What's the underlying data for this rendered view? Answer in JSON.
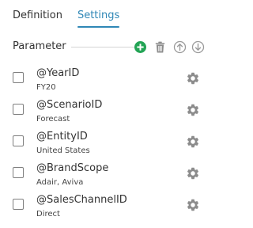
{
  "tabs": [
    {
      "label": "Definition",
      "active": false
    },
    {
      "label": "Settings",
      "active": true
    }
  ],
  "parameter": {
    "title": "Parameter"
  },
  "toolbar": {
    "add_icon": "plus-circle-icon",
    "delete_icon": "trash-icon",
    "move_up_icon": "arrow-up-circle-icon",
    "move_down_icon": "arrow-down-circle-icon"
  },
  "parameters": [
    {
      "name": "@YearID",
      "value": "FY20",
      "checked": false,
      "icon": "gear-icon"
    },
    {
      "name": "@ScenarioID",
      "value": "Forecast",
      "checked": false,
      "icon": "gear-icon"
    },
    {
      "name": "@EntityID",
      "value": "United States",
      "checked": false,
      "icon": "gear-icon"
    },
    {
      "name": "@BrandScope",
      "value": "Adair, Aviva",
      "checked": false,
      "icon": "gear-icon"
    },
    {
      "name": "@SalesChannelID",
      "value": "Direct",
      "checked": false,
      "icon": "gear-icon"
    }
  ],
  "colors": {
    "accent": "#2f87b6",
    "add": "#23a455",
    "icon_gray": "#8c8c8c",
    "text": "#333333"
  }
}
